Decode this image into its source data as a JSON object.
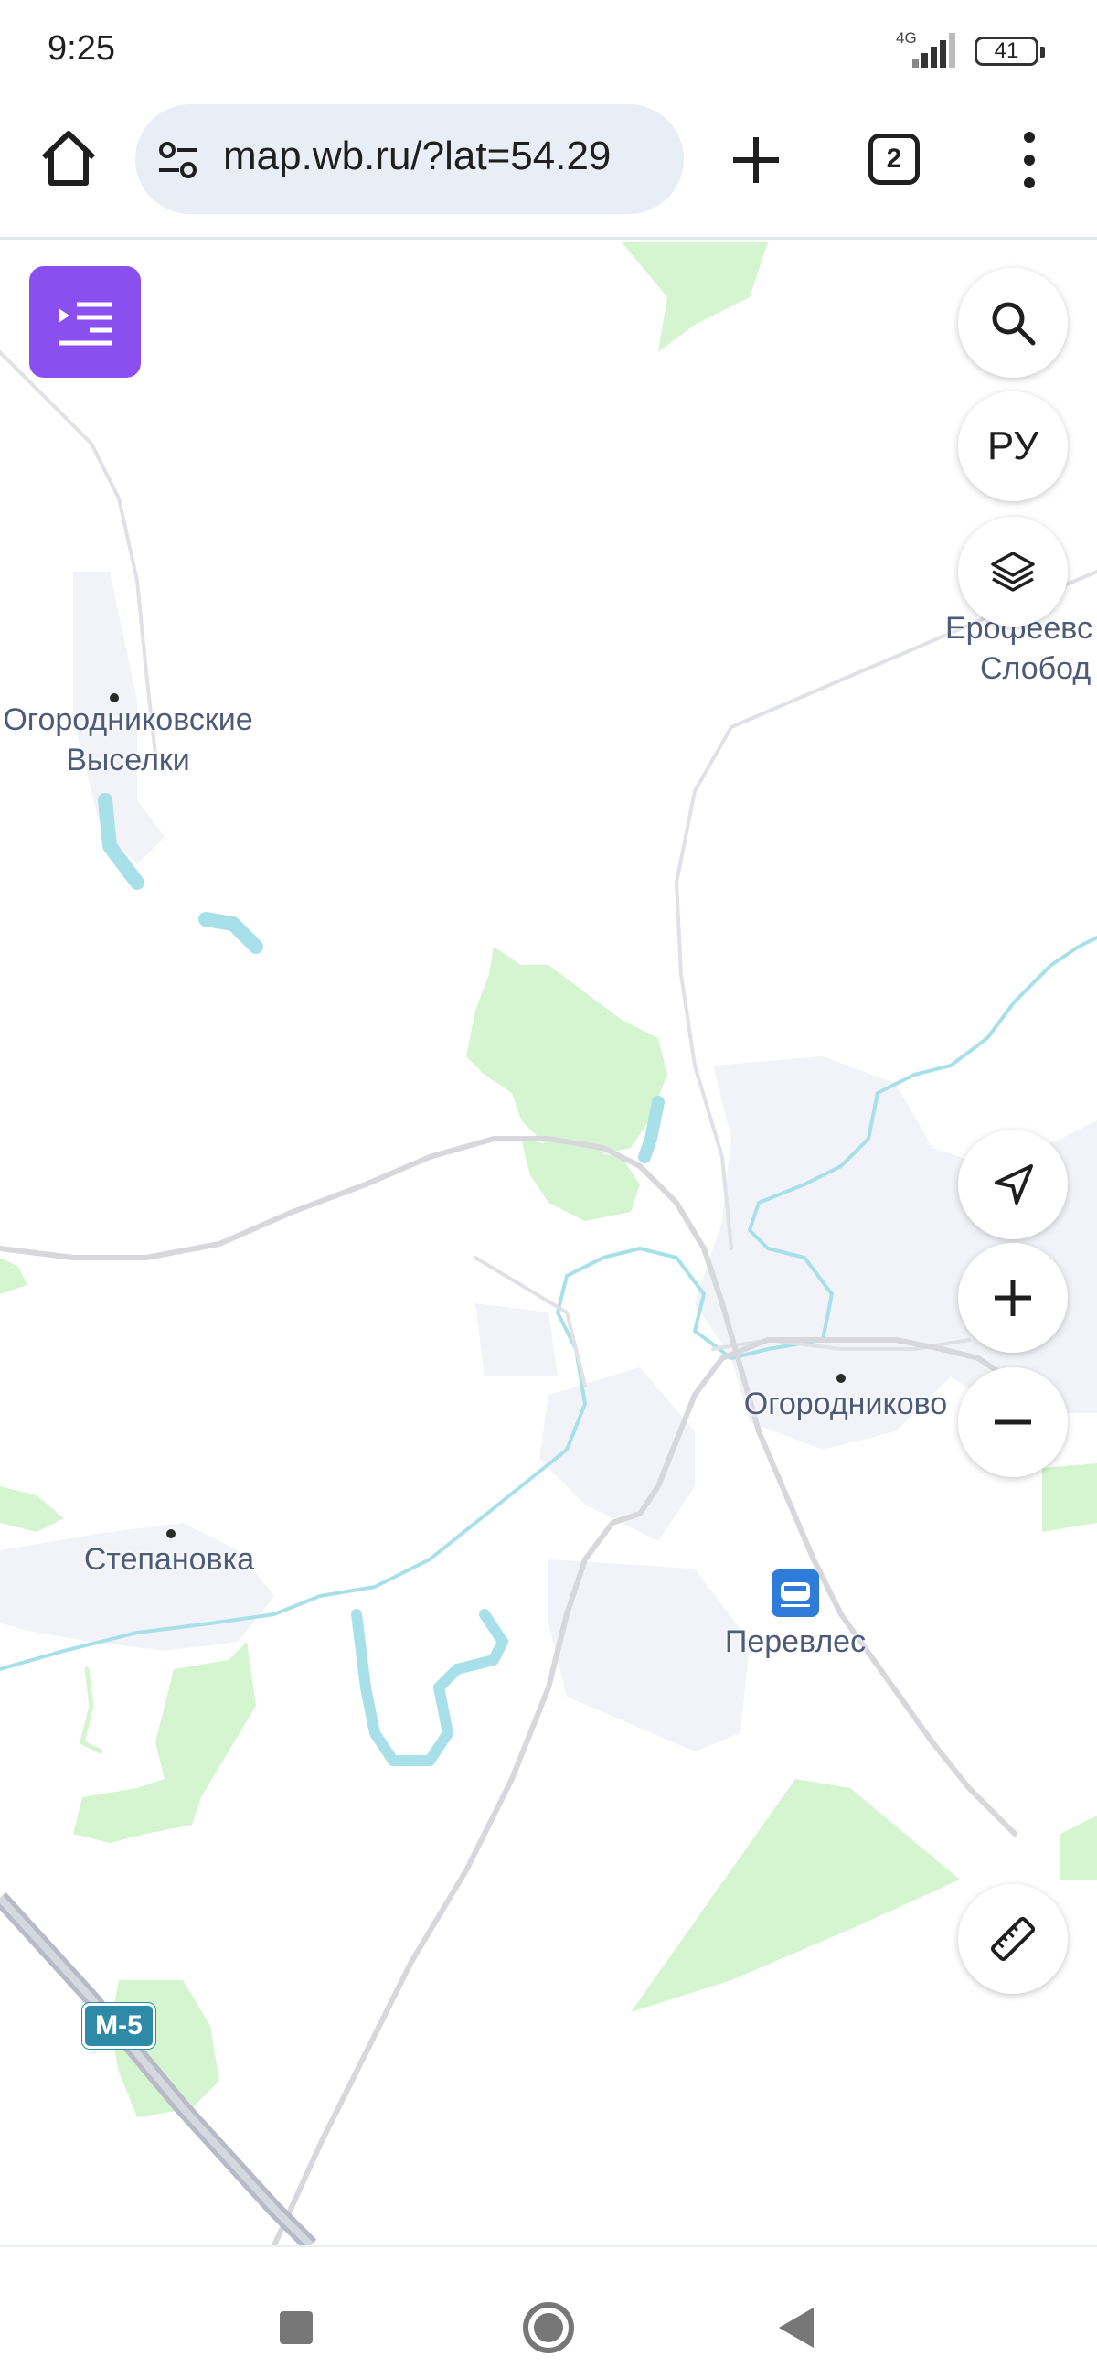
{
  "status": {
    "time": "9:25",
    "network": "4G",
    "battery": "41"
  },
  "browser": {
    "url": "map.wb.ru/?lat=54.29",
    "tab_count": "2"
  },
  "map": {
    "places": [
      {
        "line1": "Огородниковские",
        "line2": "Выселки"
      },
      {
        "line1": "Ерофеевс",
        "line2": "Слобод"
      },
      {
        "line1": "Огородниково"
      },
      {
        "line1": "Степановка"
      },
      {
        "line1": "Перевлес"
      }
    ],
    "road_badge": "М-5"
  },
  "controls": {
    "language": "РУ"
  },
  "colors": {
    "accent": "#8b4ff0",
    "forest": "#d4f5d0",
    "water": "#a8e0ea",
    "road": "#d8d8dc",
    "highway": "#b8bac7",
    "station": "#2f7bd9"
  }
}
